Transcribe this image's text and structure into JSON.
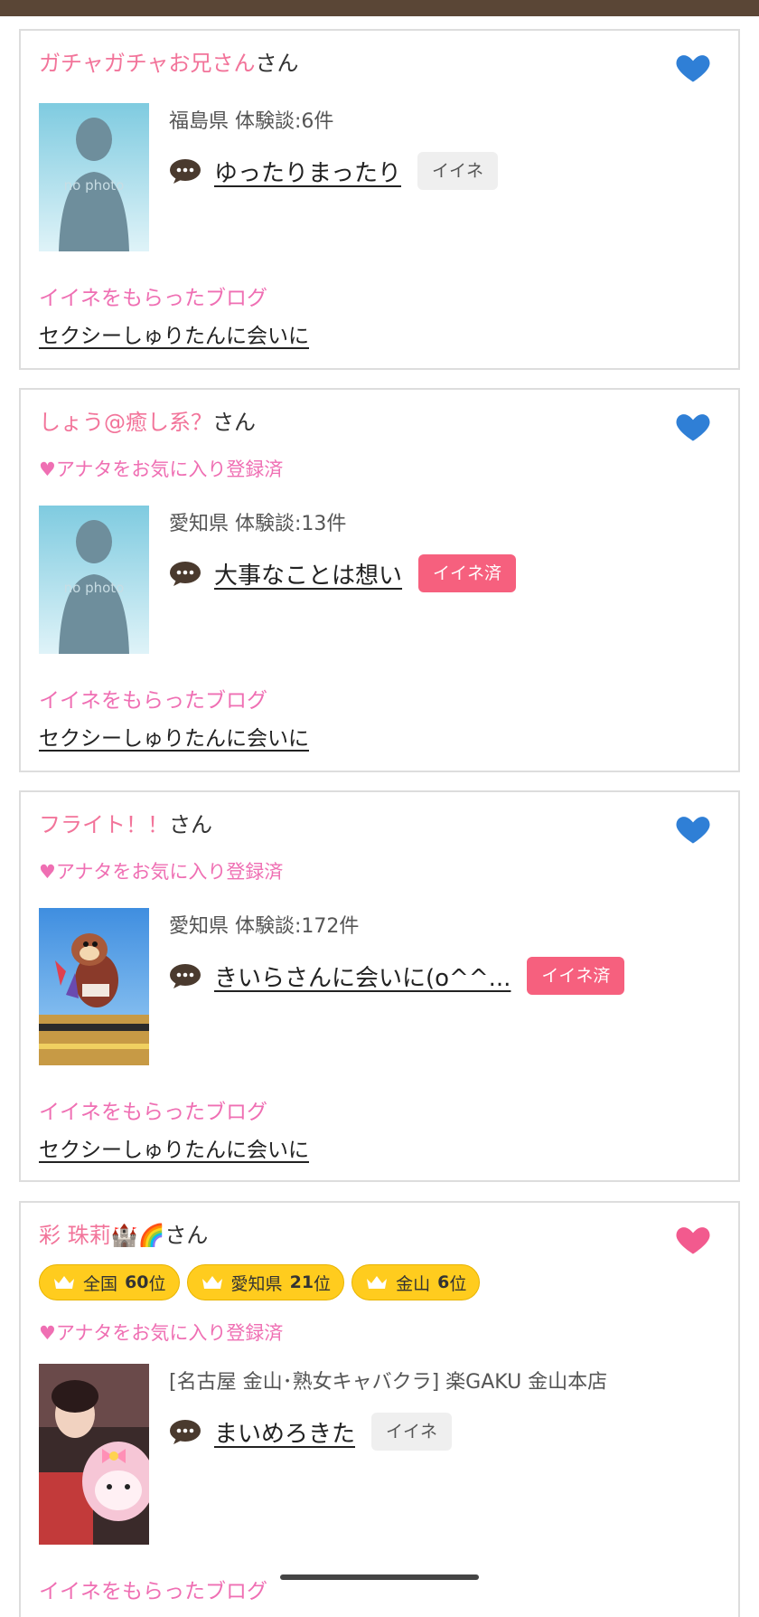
{
  "colors": {
    "accent_pink": "#f2749a",
    "heart_blue": "#2f7fd6",
    "heart_pink": "#f25a8e",
    "done_red": "#f6607e",
    "badge_gold": "#ffcc1e"
  },
  "cards": [
    {
      "name": "ガチャガチャお兄さん",
      "suffix": "さん",
      "heart_color": "blue",
      "fav_status": "",
      "thumb": "no photo",
      "meta": "福島県  体験談:6件",
      "comment": "ゆったりまったり",
      "iine_label": "イイネ",
      "iine_done": false,
      "blog_heading": "イイネをもらったブログ",
      "blog_title": "セクシーしゅりたんに会いに"
    },
    {
      "name": "しょう@癒し系？",
      "suffix": "さん",
      "heart_color": "blue",
      "fav_status": "♥アナタをお気に入り登録済",
      "thumb": "no photo",
      "meta": "愛知県  体験談:13件",
      "comment": "大事なことは想い",
      "iine_label": "イイネ済",
      "iine_done": true,
      "blog_heading": "イイネをもらったブログ",
      "blog_title": "セクシーしゅりたんに会いに"
    },
    {
      "name": "フライト！！",
      "suffix": "さん",
      "heart_color": "blue",
      "fav_status": "♥アナタをお気に入り登録済",
      "thumb": "photo",
      "meta": "愛知県  体験談:172件",
      "comment": "きいらさんに会いに(o^^...",
      "iine_label": "イイネ済",
      "iine_done": true,
      "blog_heading": "イイネをもらったブログ",
      "blog_title": "セクシーしゅりたんに会いに"
    },
    {
      "name": "彩 珠莉🏰🌈",
      "suffix": "さん",
      "heart_color": "pink",
      "ranks": [
        {
          "area": "全国",
          "rank": "60",
          "unit": "位"
        },
        {
          "area": "愛知県",
          "rank": "21",
          "unit": "位"
        },
        {
          "area": "金山",
          "rank": "6",
          "unit": "位"
        }
      ],
      "fav_status": "♥アナタをお気に入り登録済",
      "thumb": "photo",
      "meta": "[名古屋 金山･熟女キャバクラ] 楽GAKU 金山本店",
      "comment": "まいめろきた",
      "iine_label": "イイネ",
      "iine_done": false,
      "blog_heading": "イイネをもらったブログ"
    }
  ]
}
